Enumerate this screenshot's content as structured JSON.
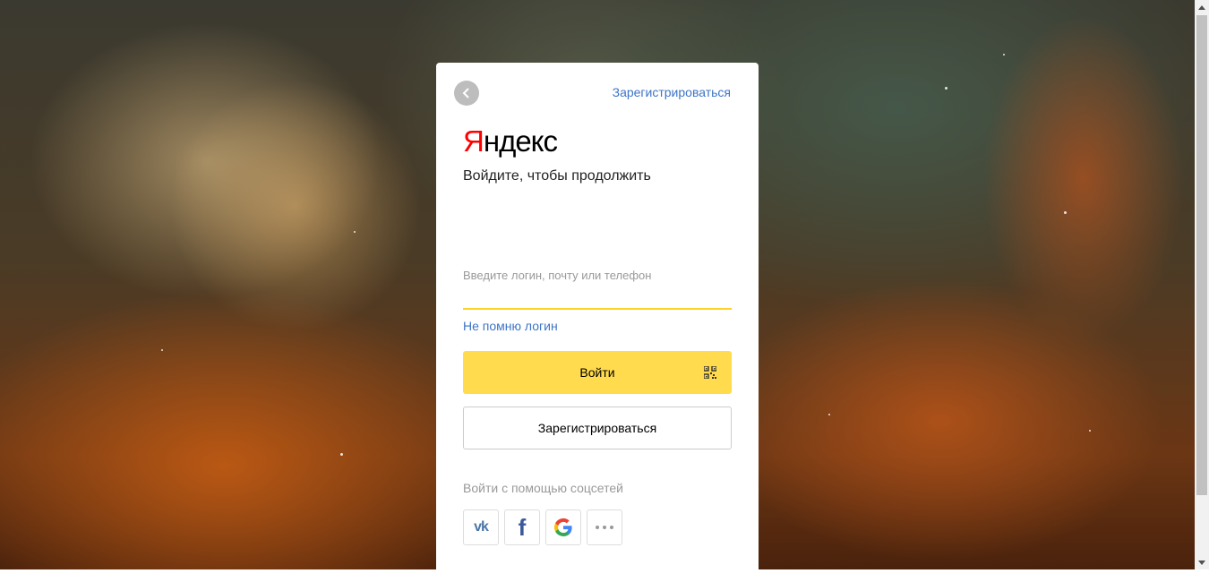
{
  "header": {
    "register_link": "Зарегистрироваться"
  },
  "brand": {
    "logo_first_letter": "Я",
    "logo_rest": "ндекс",
    "logo_first_color": "#ff0000"
  },
  "form": {
    "subtitle": "Войдите, чтобы продолжить",
    "login_label": "Введите логин, почту или телефон",
    "login_value": "",
    "forgot_link": "Не помню логин",
    "login_button": "Войти",
    "register_button": "Зарегистрироваться"
  },
  "social": {
    "label": "Войти с помощью соцсетей",
    "providers": [
      {
        "name": "vk",
        "icon": "vk-icon",
        "text": "vk"
      },
      {
        "name": "facebook",
        "icon": "facebook-icon",
        "text": "f"
      },
      {
        "name": "google",
        "icon": "google-icon"
      },
      {
        "name": "more",
        "icon": "more-dots-icon"
      }
    ]
  },
  "colors": {
    "accent_yellow": "#ffdb4d",
    "link_blue": "#3d74c8"
  },
  "icons": {
    "back": "back-arrow-icon",
    "qr": "qr-code-icon"
  }
}
